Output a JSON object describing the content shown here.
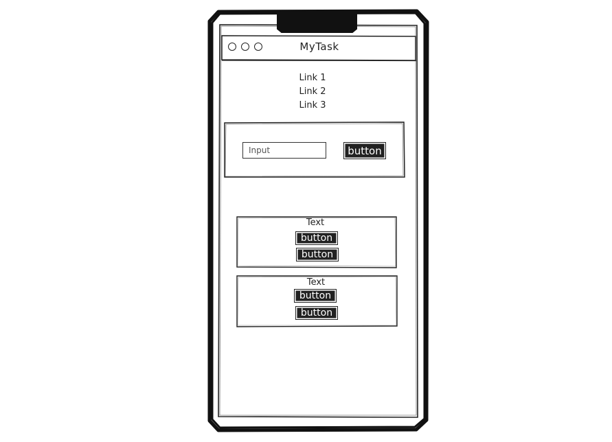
{
  "window": {
    "title": "MyTask",
    "control_icons": [
      "circle-icon",
      "circle-icon",
      "circle-icon"
    ]
  },
  "nav": {
    "links": [
      "Link 1",
      "Link 2",
      "Link 3"
    ]
  },
  "form": {
    "input_placeholder": "Input",
    "button_label": "button"
  },
  "cards": [
    {
      "text": "Text",
      "buttons": [
        "button",
        "button"
      ]
    },
    {
      "text": "Text",
      "buttons": [
        "button",
        "button"
      ]
    }
  ],
  "colors": {
    "ink": "#222222",
    "background": "#ffffff",
    "button_fill": "#222222",
    "button_text": "#ffffff"
  }
}
